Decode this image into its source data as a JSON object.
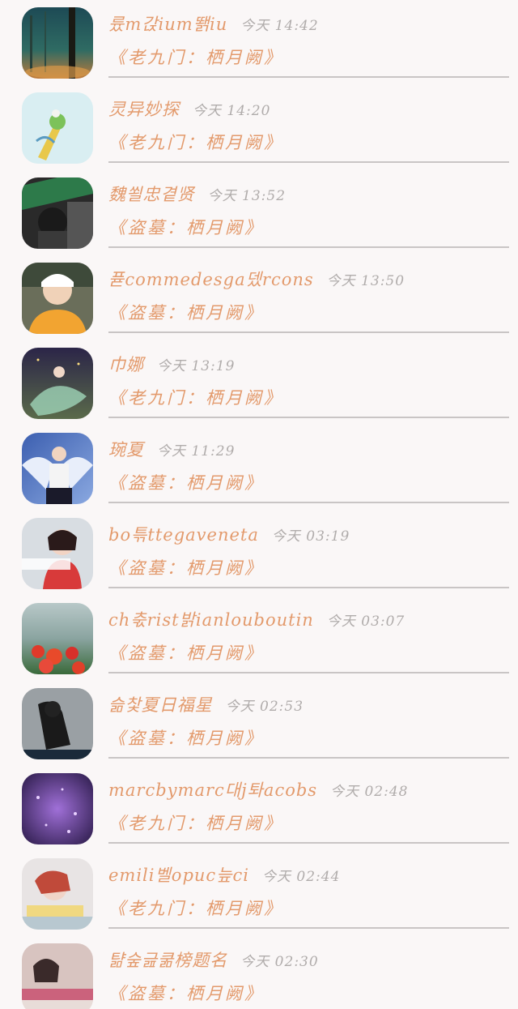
{
  "messages": [
    {
      "name": "륬m갅ium뙑iu",
      "time": "今天 14:42",
      "title": "《老九门：栖月阙》",
      "avatar": "forest-avatar"
    },
    {
      "name": "灵异妙探",
      "time": "今天 14:20",
      "title": "《老九门：栖月阙》",
      "avatar": "plant-avatar"
    },
    {
      "name": "魏쐴忠곁贤",
      "time": "今天 13:52",
      "title": "《盗墓：栖月阙》",
      "avatar": "dark-portrait-avatar"
    },
    {
      "name": "퓯commedesga뎄rcons",
      "time": "今天 13:50",
      "title": "《盗墓：栖月阙》",
      "avatar": "girl-yellow-avatar"
    },
    {
      "name": "巾娜",
      "time": "今天 13:19",
      "title": "《老九门：栖月阙》",
      "avatar": "fairy-avatar"
    },
    {
      "name": "琬夏",
      "time": "今天 11:29",
      "title": "《盗墓：栖月阙》",
      "avatar": "angel-avatar"
    },
    {
      "name": "bo튺ttegaveneta",
      "time": "今天 03:19",
      "title": "《盗墓：栖月阙》",
      "avatar": "girl-red-avatar"
    },
    {
      "name": "ch춗rist밝ianlouboutin",
      "time": "今天 03:07",
      "title": "《盗墓：栖月阙》",
      "avatar": "flowers-avatar"
    },
    {
      "name": "슮찿夏日福星",
      "time": "今天 02:53",
      "title": "《盗墓：栖月阙》",
      "avatar": "sitting-girl-avatar"
    },
    {
      "name": "marcbymarc대j톼acobs",
      "time": "今天 02:48",
      "title": "《老九门：栖月阙》",
      "avatar": "purple-sparkle-avatar"
    },
    {
      "name": "emili벨opuc늪ci",
      "time": "今天 02:44",
      "title": "《老九门：栖月阙》",
      "avatar": "girl-lying-avatar"
    },
    {
      "name": "턂숲긆쿪榜题名",
      "time": "今天 02:30",
      "title": "《盗墓：栖月阙》",
      "avatar": "girl-pink-avatar"
    }
  ]
}
